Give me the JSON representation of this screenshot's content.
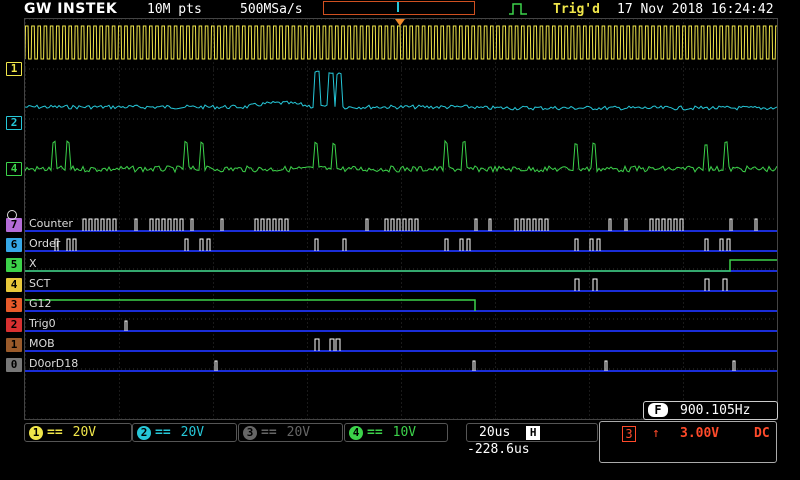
{
  "header": {
    "brand": "GW INSTEK",
    "record_length": "10M pts",
    "sample_rate": "500MSa/s",
    "trigger_status": "Trig'd",
    "datetime": "17 Nov 2018 16:24:42"
  },
  "analog_markers": [
    "1",
    "2",
    "4"
  ],
  "digital": [
    {
      "num": "7",
      "label": "Counter",
      "color": "#b46cd8"
    },
    {
      "num": "6",
      "label": "Order",
      "color": "#36a8e8"
    },
    {
      "num": "5",
      "label": "X",
      "color": "#3cd24a"
    },
    {
      "num": "4",
      "label": "SCT",
      "color": "#e8c83a"
    },
    {
      "num": "3",
      "label": "G12",
      "color": "#e85a2a"
    },
    {
      "num": "2",
      "label": "Trig0",
      "color": "#d83030"
    },
    {
      "num": "1",
      "label": "MOB",
      "color": "#9a5a2a"
    },
    {
      "num": "0",
      "label": "D0orD18",
      "color": "#777777"
    }
  ],
  "channels": [
    {
      "num": "1",
      "coupling": "==",
      "scale": "20V",
      "color": "#f0e64a"
    },
    {
      "num": "2",
      "coupling": "==",
      "scale": "20V",
      "color": "#26c7d8"
    },
    {
      "num": "3",
      "coupling": "==",
      "scale": "20V",
      "color": "#666666"
    },
    {
      "num": "4",
      "coupling": "==",
      "scale": "10V",
      "color": "#3cd24a"
    }
  ],
  "timebase": {
    "scale": "20us",
    "position": "-228.6us"
  },
  "trigger": {
    "source": "3",
    "slope": "↑",
    "level": "3.00V",
    "coupling": "DC"
  },
  "frequency": {
    "badge": "F",
    "value": "900.105Hz"
  },
  "colors": {
    "ch1": "#f0e64a",
    "ch2": "#26c7d8",
    "ch4": "#3cd24a",
    "digital_base": "#1a2dd8",
    "trigger_red": "#ff4a2a"
  }
}
